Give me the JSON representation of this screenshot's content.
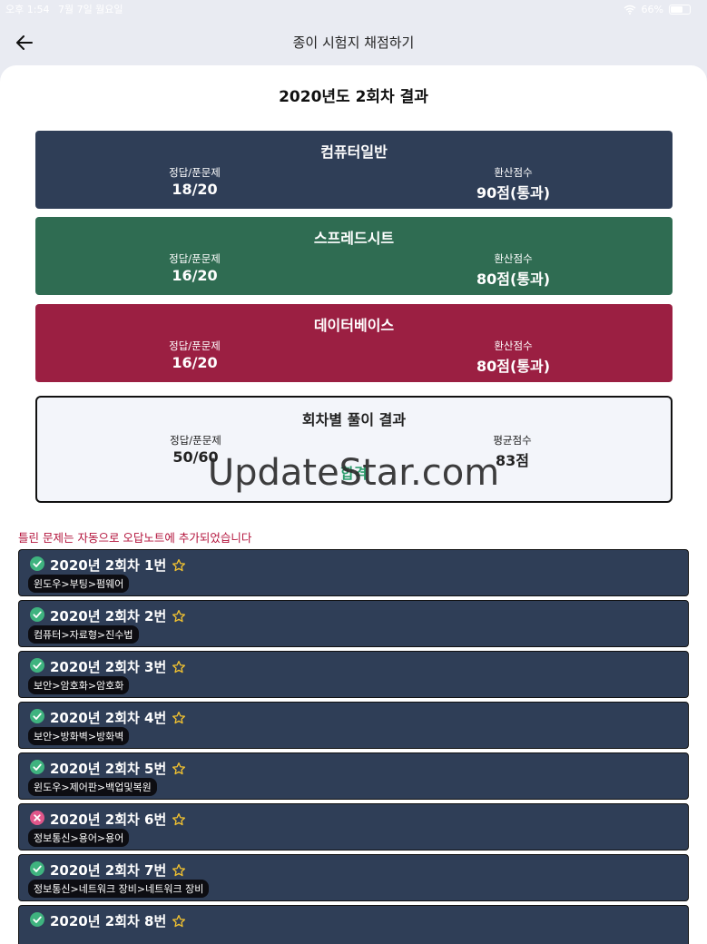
{
  "status_bar": {
    "time": "오후 1:54",
    "date": "7월 7일 월요일",
    "battery": "66%"
  },
  "app_bar": {
    "title": "종이 시험지 채점하기"
  },
  "result": {
    "title": "2020년도 2회차 결과"
  },
  "subjects": [
    {
      "name": "컴퓨터일반",
      "correct_label": "정답/푼문제",
      "correct": "18/20",
      "score_label": "환산점수",
      "score": "90점(통과)",
      "color": "#2f3e57"
    },
    {
      "name": "스프레드시트",
      "correct_label": "정답/푼문제",
      "correct": "16/20",
      "score_label": "환산점수",
      "score": "80점(통과)",
      "color": "#2f6c52"
    },
    {
      "name": "데이터베이스",
      "correct_label": "정답/푼문제",
      "correct": "16/20",
      "score_label": "환산점수",
      "score": "80점(통과)",
      "color": "#9b1f42"
    }
  ],
  "summary": {
    "title": "회차별 풀이 결과",
    "correct_label": "정답/푼문제",
    "correct": "50/60",
    "avg_label": "평균점수",
    "avg": "83점",
    "verdict": "합격",
    "pass_color": "#2e9e6e"
  },
  "watermark": "UpdateStar.com",
  "notice": "틀린 문제는 자동으로 오답노트에 추가되었습니다",
  "questions": [
    {
      "title": "2020년 2회차 1번",
      "tag": "윈도우>부팅>펌웨어",
      "status_icon": "check-circle-icon",
      "correct": true
    },
    {
      "title": "2020년 2회차 2번",
      "tag": "컴퓨터>자료형>진수법",
      "status_icon": "check-circle-icon",
      "correct": true
    },
    {
      "title": "2020년 2회차 3번",
      "tag": "보안>암호화>암호화",
      "status_icon": "check-circle-icon",
      "correct": true
    },
    {
      "title": "2020년 2회차 4번",
      "tag": "보안>방화벽>방화벽",
      "status_icon": "check-circle-icon",
      "correct": true
    },
    {
      "title": "2020년 2회차 5번",
      "tag": "윈도우>제어판>백업및복원",
      "status_icon": "check-circle-icon",
      "correct": true
    },
    {
      "title": "2020년 2회차 6번",
      "tag": "정보통신>용어>용어",
      "status_icon": "x-circle-icon",
      "correct": false
    },
    {
      "title": "2020년 2회차 7번",
      "tag": "정보통신>네트워크 장비>네트워크 장비",
      "status_icon": "check-circle-icon",
      "correct": true
    },
    {
      "title": "2020년 2회차 8번",
      "tag": "",
      "status_icon": "check-circle-icon",
      "correct": true
    }
  ],
  "colors": {
    "correct": "#3fb37f",
    "wrong": "#e0568a",
    "star": "#f2c230"
  }
}
